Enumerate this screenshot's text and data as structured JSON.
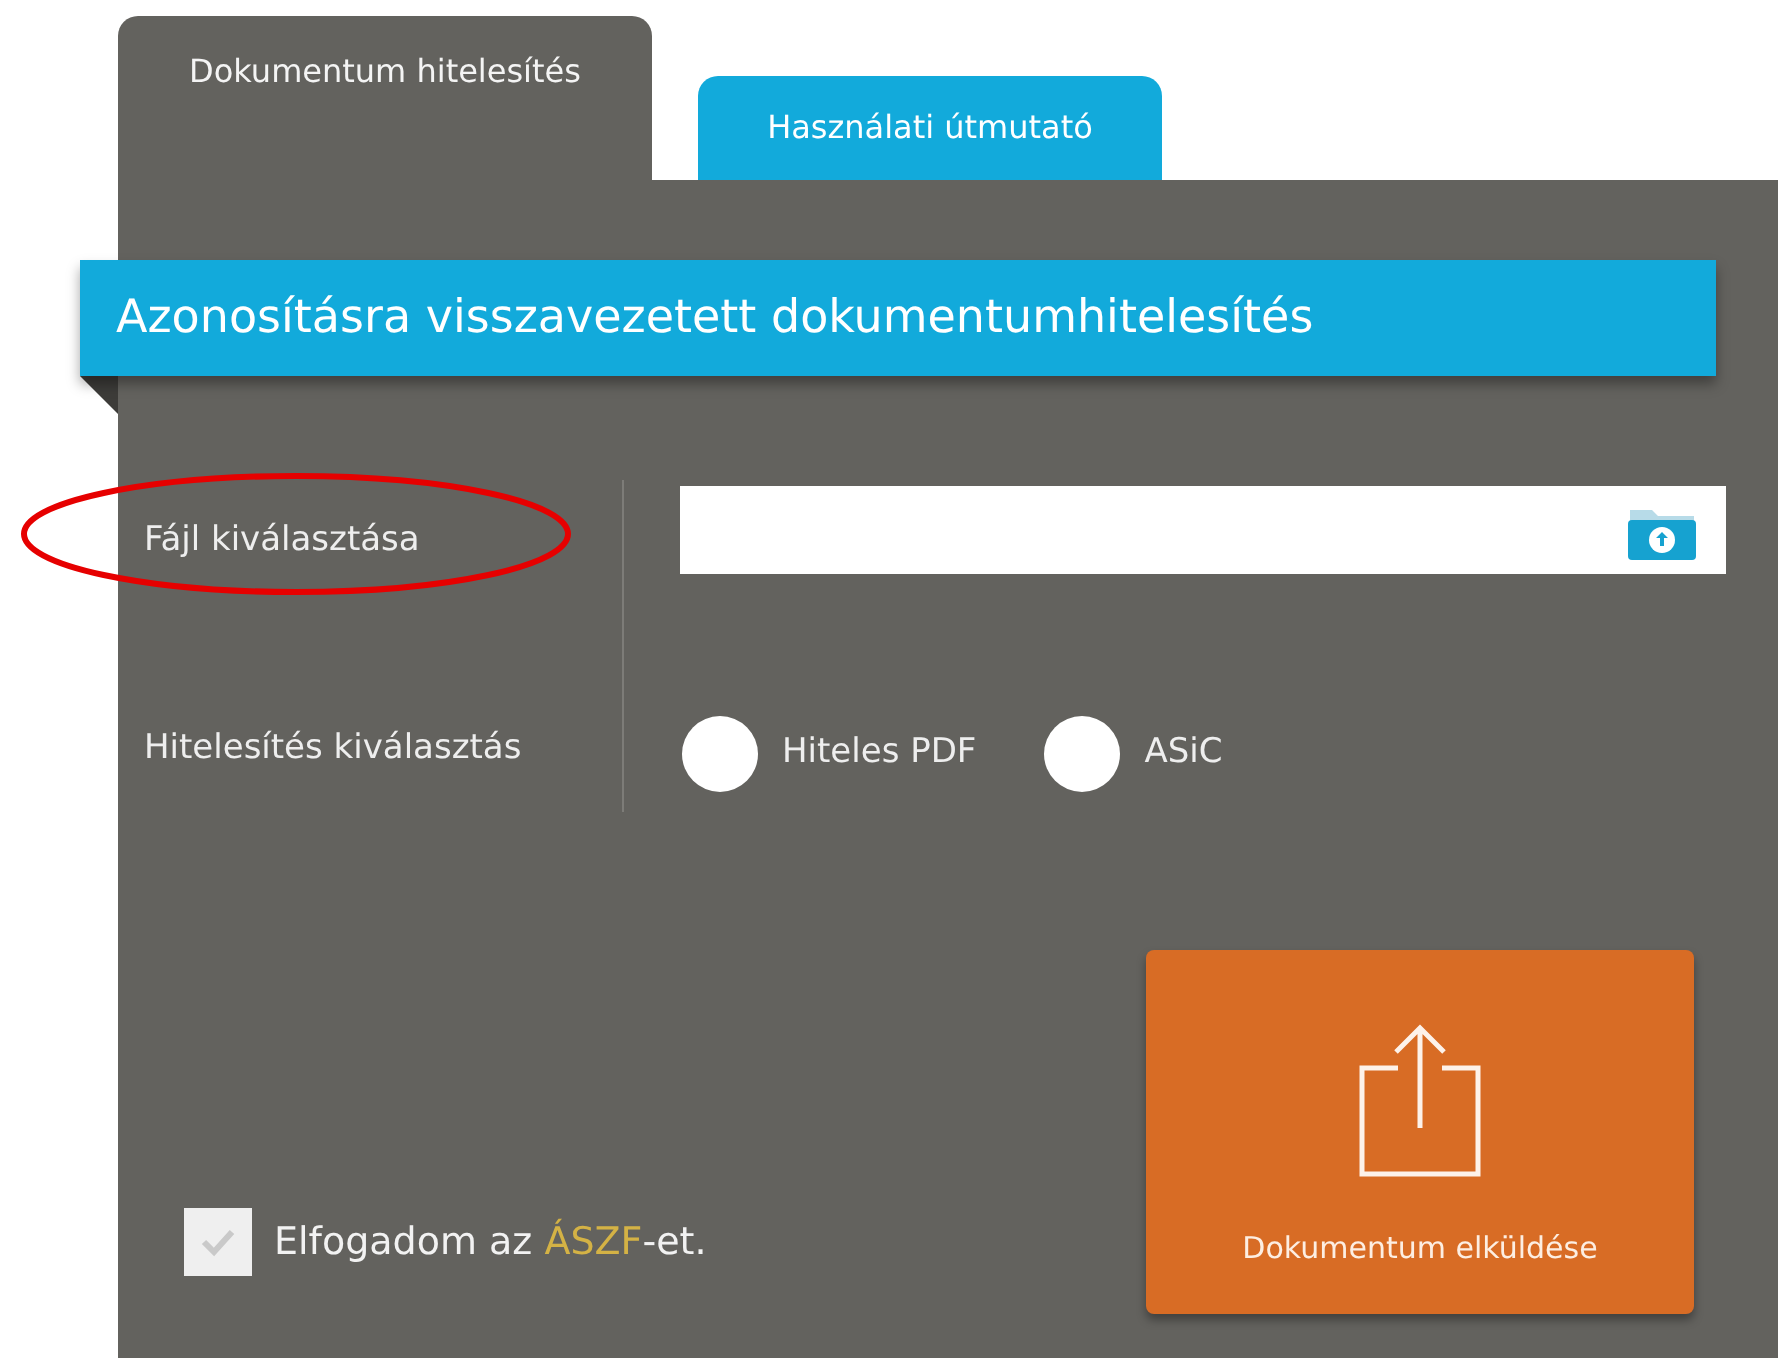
{
  "tabs": [
    {
      "label": "Dokumentum hitelesítés",
      "selected": true
    },
    {
      "label": "Használati útmutató",
      "selected": false
    }
  ],
  "header": {
    "title": "Azonosításra visszavezetett dokumentumhitelesítés"
  },
  "form": {
    "file_label": "Fájl kiválasztása",
    "auth_label": "Hitelesítés kiválasztás",
    "options": [
      {
        "label": "Hiteles PDF",
        "selected": false
      },
      {
        "label": "ASiC",
        "selected": false
      }
    ]
  },
  "terms": {
    "checked": false,
    "before": "Elfogadom az ",
    "link": "ÁSZF",
    "after": "-et."
  },
  "submit": {
    "label": "Dokumentum elküldése"
  },
  "annotation": {
    "kind": "ellipse",
    "color": "#e60000"
  }
}
